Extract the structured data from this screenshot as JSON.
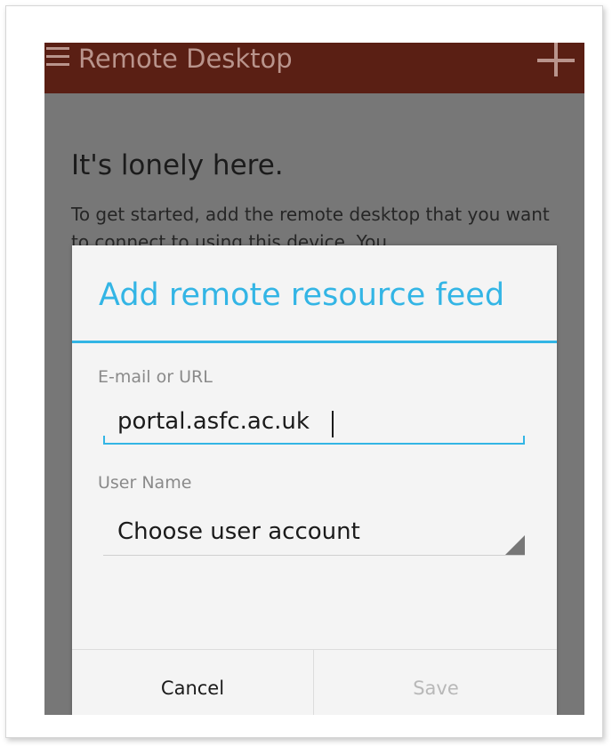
{
  "app_bar": {
    "title": "Remote Desktop",
    "menu_icon": "hamburger-menu-icon",
    "add_icon": "plus-icon",
    "color": "#5a1f14"
  },
  "empty_state": {
    "title": "It's lonely here.",
    "body": "To get started, add the remote desktop that you want to connect to using this device. You"
  },
  "dialog": {
    "title": "Add remote resource feed",
    "accent_color": "#33b5e5",
    "url_field": {
      "label": "E-mail or URL",
      "value": "portal.asfc.ac.uk"
    },
    "user_field": {
      "label": "User Name",
      "selected": "Choose user account"
    },
    "buttons": {
      "cancel": "Cancel",
      "save": "Save"
    }
  }
}
